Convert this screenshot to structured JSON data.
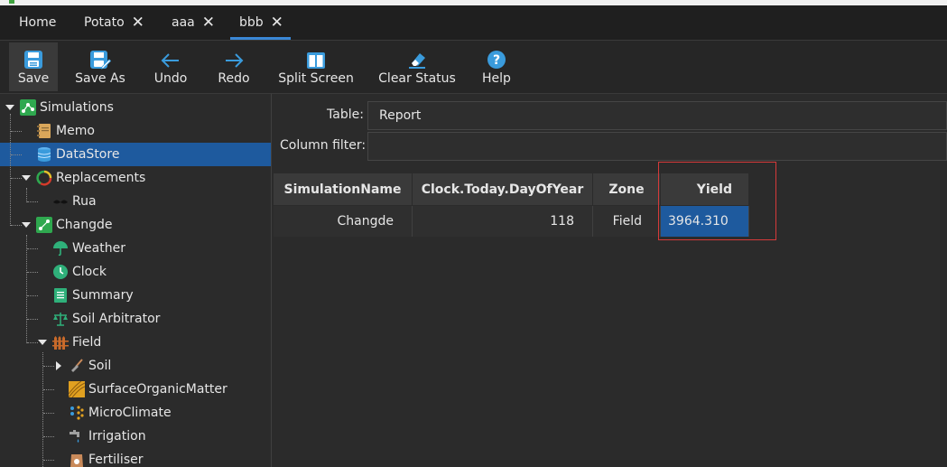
{
  "tabs": [
    {
      "label": "Home",
      "closable": false
    },
    {
      "label": "Potato",
      "closable": true
    },
    {
      "label": "aaa",
      "closable": true
    },
    {
      "label": "bbb",
      "closable": true,
      "active": true
    }
  ],
  "close_glyph": "✕",
  "toolbar": {
    "save": "Save",
    "save_as": "Save As",
    "undo": "Undo",
    "redo": "Redo",
    "split_screen": "Split Screen",
    "clear_status": "Clear Status",
    "help": "Help"
  },
  "tree": {
    "simulations": "Simulations",
    "memo": "Memo",
    "datastore": "DataStore",
    "replacements": "Replacements",
    "rua": "Rua",
    "changde": "Changde",
    "weather": "Weather",
    "clock": "Clock",
    "summary": "Summary",
    "soil_arbitrator": "Soil Arbitrator",
    "field": "Field",
    "soil": "Soil",
    "surface_organic_matter": "SurfaceOrganicMatter",
    "microclimate": "MicroClimate",
    "irrigation": "Irrigation",
    "fertiliser": "Fertiliser"
  },
  "main": {
    "table_label": "Table:",
    "table_value": "Report",
    "column_filter_label": "Column filter:",
    "column_filter_value": ""
  },
  "grid": {
    "columns": [
      "SimulationName",
      "Clock.Today.DayOfYear",
      "Zone",
      "Yield"
    ],
    "rows": [
      [
        "Changde",
        "118",
        "Field",
        "3964.310"
      ]
    ]
  },
  "colors": {
    "accent": "#3a87d6",
    "selection": "#1e5a9e",
    "highlight_box": "#d63a3a"
  }
}
